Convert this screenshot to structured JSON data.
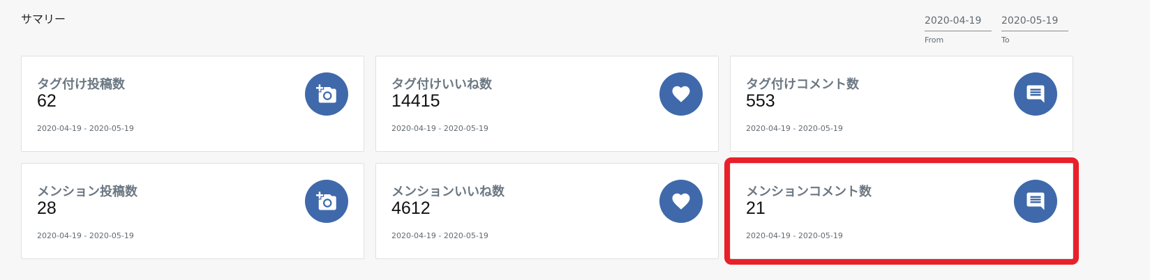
{
  "page": {
    "title": "サマリー"
  },
  "date_range": {
    "from_value": "2020-04-19",
    "from_label": "From",
    "to_value": "2020-05-19",
    "to_label": "To"
  },
  "cards": [
    {
      "title": "タグ付け投稿数",
      "value": "62",
      "range": "2020-04-19 - 2020-05-19",
      "icon": "add-photo-icon"
    },
    {
      "title": "タグ付けいいね数",
      "value": "14415",
      "range": "2020-04-19 - 2020-05-19",
      "icon": "heart-icon"
    },
    {
      "title": "タグ付けコメント数",
      "value": "553",
      "range": "2020-04-19 - 2020-05-19",
      "icon": "comment-icon"
    },
    {
      "title": "メンション投稿数",
      "value": "28",
      "range": "2020-04-19 - 2020-05-19",
      "icon": "add-photo-icon"
    },
    {
      "title": "メンションいいね数",
      "value": "4612",
      "range": "2020-04-19 - 2020-05-19",
      "icon": "heart-icon"
    },
    {
      "title": "メンションコメント数",
      "value": "21",
      "range": "2020-04-19 - 2020-05-19",
      "icon": "comment-icon"
    }
  ],
  "colors": {
    "icon_background": "#3f69aa",
    "highlight": "#e8202a",
    "title_text": "#6b7782"
  }
}
